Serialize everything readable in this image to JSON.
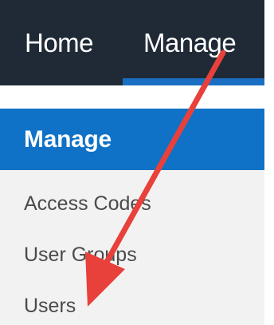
{
  "nav": {
    "tabs": [
      {
        "label": "Home"
      },
      {
        "label": "Manage",
        "active": true
      }
    ]
  },
  "sidebar": {
    "header": "Manage",
    "items": [
      {
        "label": "Access Codes"
      },
      {
        "label": "User Groups"
      },
      {
        "label": "Users"
      }
    ]
  },
  "colors": {
    "top_bar": "#1f2a36",
    "active_tab_underline": "#1a6fc3",
    "sidebar_header": "#0f72c6",
    "sidebar_bg": "#f2f2f2",
    "menu_text": "#4a4a4a",
    "annotation_arrow": "#e8403a"
  },
  "annotation": {
    "type": "arrow",
    "from": "nav-tab-manage",
    "to": "sidebar-item-users"
  }
}
